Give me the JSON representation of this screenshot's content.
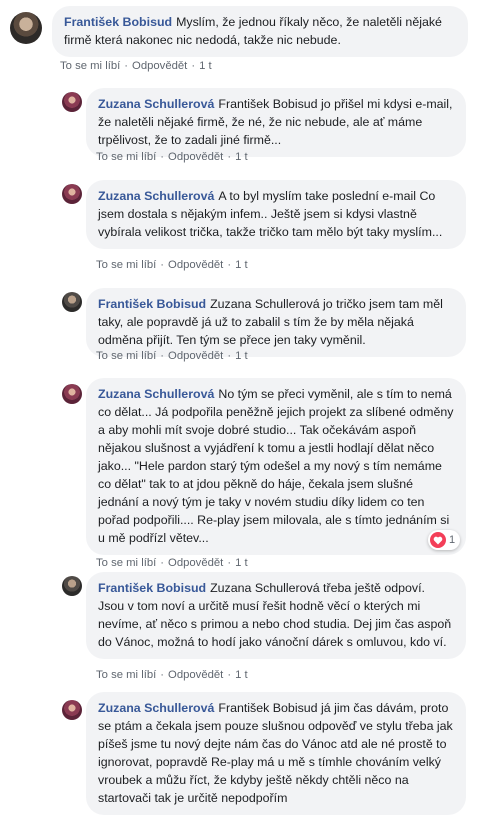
{
  "actions": {
    "like": "To se mi líbí",
    "reply": "Odpovědět",
    "sep": "·"
  },
  "comments": [
    {
      "author": "František Bobisud",
      "text": "Myslím, že jednou říkaly něco, že naletěli nějaké firmě která nakonec nic nedodá, takže nic nebude.",
      "time": "1 t"
    },
    {
      "author": "Zuzana Schullerová",
      "text": "František Bobisud jo přišel mi kdysi e-mail, že naletěli nějaké firmě, že né, že nic nebude, ale ať máme trpělivost, že to zadali jiné firmě...",
      "time": "1 t"
    },
    {
      "author": "Zuzana Schullerová",
      "text": "A to byl myslím take poslední e-mail Co jsem dostala s nějakým infem.. Ještě jsem si kdysi vlastně vybírala velikost trička, takže tričko tam mělo být taky myslím...",
      "time": "1 t"
    },
    {
      "author": "František Bobisud",
      "text": "Zuzana Schullerová jo tričko jsem tam měl taky, ale popravdě já už to zabalil s tím že by měla nějaká odměna přijít. Ten tým se přece jen taky vyměnil.",
      "time": "1 t"
    },
    {
      "author": "Zuzana Schullerová",
      "text": "No tým se přeci vyměnil, ale s tím to nemá co dělat... Já podpořila peněžně jejich projekt za slíbené odměny a aby mohli mít svoje dobré studio... Tak očekávám aspoň nějakou slušnost a vyjádření k tomu a jestli hodlají dělat něco jako... \"Hele pardon starý tým odešel a my nový s tím nemáme co dělat\" tak to at jdou pěkně do háje, čekala jsem slušné jednání a nový tým je taky v novém studiu díky lidem co ten pořad podpořili.... Re-play jsem milovala, ale s tímto jednáním si u mě podřízl větev...",
      "time": "1 t",
      "reactions": "1"
    },
    {
      "author": "František Bobisud",
      "text": "Zuzana Schullerová třeba ještě odpoví. Jsou v tom noví a určitě musí řešit hodně věcí o kterých mi nevíme, ať něco s primou a nebo chod studia. Dej jim čas aspoň do Vánoc, možná to hodí jako vánoční dárek s omluvou, kdo ví.",
      "time": "1 t"
    },
    {
      "author": "Zuzana Schullerová",
      "text": "František Bobisud já jim čas dávám, proto se ptám a čekala jsem pouze slušnou odpověď ve stylu třeba jak píšeš jsme tu nový dejte nám čas do Vánoc atd ale né prostě to ignorovat, popravdě Re-play má u mě s tímhle chováním velký vroubek a můžu říct, že kdyby ještě někdy chtěli něco na startovači tak je určitě nepodpořím",
      "time": ""
    }
  ]
}
